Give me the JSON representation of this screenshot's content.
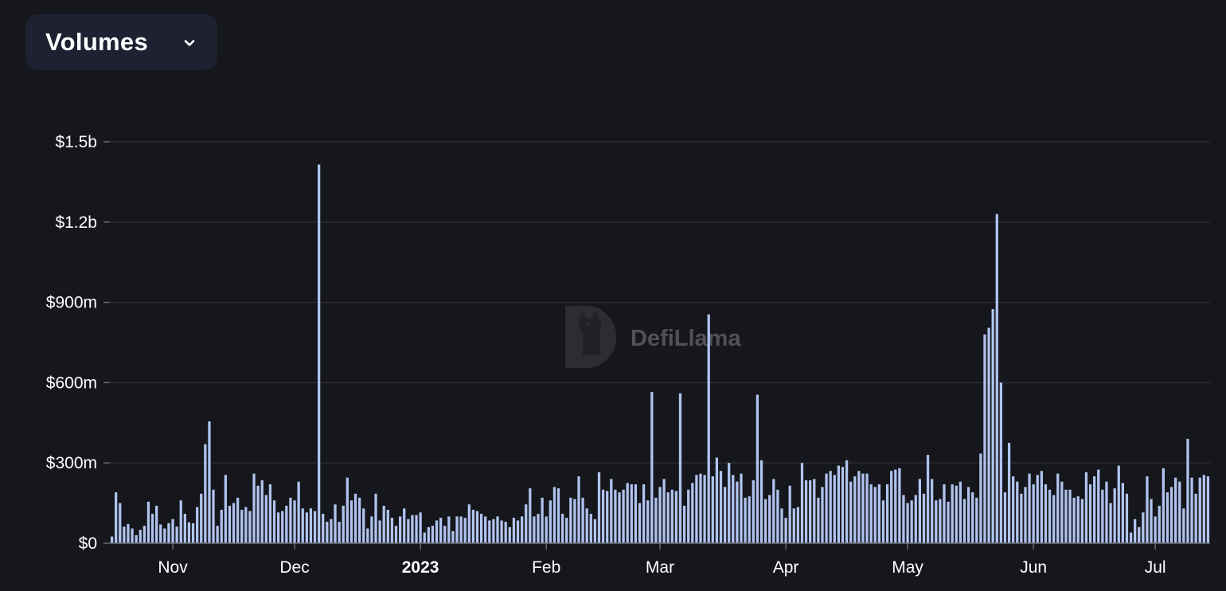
{
  "dropdown": {
    "label": "Volumes",
    "icon": "chevron-down-icon"
  },
  "watermark": {
    "text": "DefiLlama",
    "icon": "defillama-logo-icon"
  },
  "colors": {
    "background": "#16171c",
    "bar": "#b0c4ef",
    "grid": "#2c2e35",
    "tick_text": "#ffffff",
    "dropdown_bg": "#1d2131"
  },
  "chart_data": {
    "type": "bar",
    "xlabel": "",
    "ylabel": "",
    "ylim": [
      0,
      1500000000
    ],
    "y_ticks": [
      {
        "value": 0,
        "label": "$0"
      },
      {
        "value": 300000000,
        "label": "$300m"
      },
      {
        "value": 600000000,
        "label": "$600m"
      },
      {
        "value": 900000000,
        "label": "$900m"
      },
      {
        "value": 1200000000,
        "label": "$1.2b"
      },
      {
        "value": 1500000000,
        "label": "$1.5b"
      }
    ],
    "x_start": "2022-10-17",
    "x_end": "2023-07-13",
    "x_ticks": [
      {
        "date": "2022-11-01",
        "label": "Nov",
        "bold": false
      },
      {
        "date": "2022-12-01",
        "label": "Dec",
        "bold": false
      },
      {
        "date": "2023-01-01",
        "label": "2023",
        "bold": true
      },
      {
        "date": "2023-02-01",
        "label": "Feb",
        "bold": false
      },
      {
        "date": "2023-03-01",
        "label": "Mar",
        "bold": false
      },
      {
        "date": "2023-04-01",
        "label": "Apr",
        "bold": false
      },
      {
        "date": "2023-05-01",
        "label": "May",
        "bold": false
      },
      {
        "date": "2023-06-01",
        "label": "Jun",
        "bold": false
      },
      {
        "date": "2023-07-01",
        "label": "Jul",
        "bold": false
      }
    ],
    "grid": true,
    "legend": "none",
    "values_unit": "USD millions",
    "values": [
      25,
      190,
      150,
      62,
      72,
      55,
      30,
      50,
      65,
      155,
      110,
      140,
      70,
      55,
      75,
      90,
      62,
      160,
      110,
      78,
      75,
      135,
      185,
      370,
      455,
      200,
      65,
      125,
      255,
      140,
      150,
      170,
      125,
      135,
      120,
      260,
      215,
      235,
      180,
      220,
      160,
      115,
      120,
      140,
      170,
      160,
      230,
      130,
      115,
      130,
      120,
      1415,
      110,
      80,
      90,
      145,
      80,
      140,
      245,
      160,
      185,
      170,
      130,
      55,
      100,
      185,
      85,
      140,
      125,
      95,
      65,
      100,
      130,
      90,
      105,
      105,
      115,
      40,
      60,
      65,
      85,
      95,
      65,
      100,
      45,
      100,
      100,
      95,
      145,
      125,
      120,
      110,
      100,
      85,
      90,
      100,
      85,
      80,
      60,
      95,
      85,
      100,
      145,
      205,
      100,
      110,
      170,
      100,
      160,
      210,
      205,
      110,
      95,
      170,
      165,
      250,
      170,
      130,
      110,
      90,
      265,
      200,
      195,
      240,
      200,
      190,
      200,
      225,
      220,
      220,
      150,
      220,
      160,
      565,
      170,
      210,
      240,
      190,
      200,
      195,
      560,
      140,
      200,
      225,
      255,
      260,
      255,
      855,
      250,
      320,
      270,
      210,
      300,
      255,
      230,
      260,
      170,
      175,
      235,
      555,
      310,
      165,
      180,
      240,
      200,
      130,
      95,
      215,
      130,
      135,
      300,
      235,
      235,
      240,
      170,
      210,
      260,
      270,
      255,
      290,
      285,
      310,
      230,
      250,
      270,
      260,
      260,
      220,
      210,
      220,
      160,
      220,
      270,
      275,
      280,
      180,
      150,
      160,
      180,
      240,
      185,
      330,
      240,
      160,
      165,
      220,
      155,
      220,
      215,
      230,
      165,
      210,
      190,
      170,
      335,
      780,
      805,
      875,
      1230,
      600,
      190,
      375,
      250,
      230,
      185,
      210,
      260,
      220,
      255,
      270,
      220,
      200,
      180,
      260,
      230,
      200,
      200,
      170,
      175,
      165,
      265,
      220,
      250,
      275,
      200,
      230,
      150,
      205,
      290,
      225,
      185,
      40,
      90,
      60,
      115,
      250,
      165,
      100,
      140,
      280,
      190,
      210,
      245,
      230,
      130,
      390,
      245,
      185,
      245,
      255,
      250
    ]
  }
}
